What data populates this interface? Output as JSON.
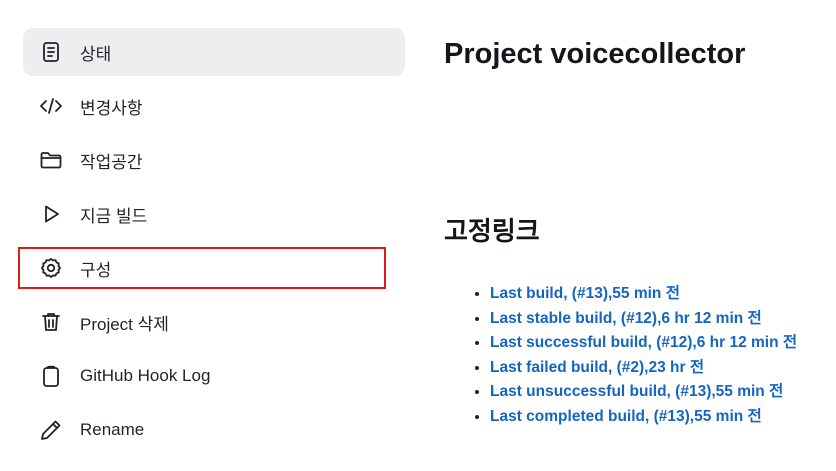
{
  "sidebar": {
    "items": [
      {
        "label": "상태",
        "icon": "document-icon",
        "active": true
      },
      {
        "label": "변경사항",
        "icon": "code-icon",
        "active": false
      },
      {
        "label": "작업공간",
        "icon": "folder-icon",
        "active": false
      },
      {
        "label": "지금 빌드",
        "icon": "play-icon",
        "active": false
      },
      {
        "label": "구성",
        "icon": "gear-icon",
        "active": false,
        "highlighted": true
      },
      {
        "label": "Project 삭제",
        "icon": "trash-icon",
        "active": false
      },
      {
        "label": "GitHub Hook Log",
        "icon": "clipboard-icon",
        "active": false
      },
      {
        "label": "Rename",
        "icon": "pencil-icon",
        "active": false
      }
    ]
  },
  "main": {
    "title": "Project voicecollector",
    "permalinks_title": "고정링크",
    "permalinks": [
      "Last build, (#13),55 min 전",
      "Last stable build, (#12),6 hr 12 min 전",
      "Last successful build, (#12),6 hr 12 min 전",
      "Last failed build, (#2),23 hr 전",
      "Last unsuccessful build, (#13),55 min 전",
      "Last completed build, (#13),55 min 전"
    ]
  },
  "colors": {
    "link": "#1565c0",
    "active_bg": "#eeeef1",
    "highlight_border": "#e01919"
  }
}
